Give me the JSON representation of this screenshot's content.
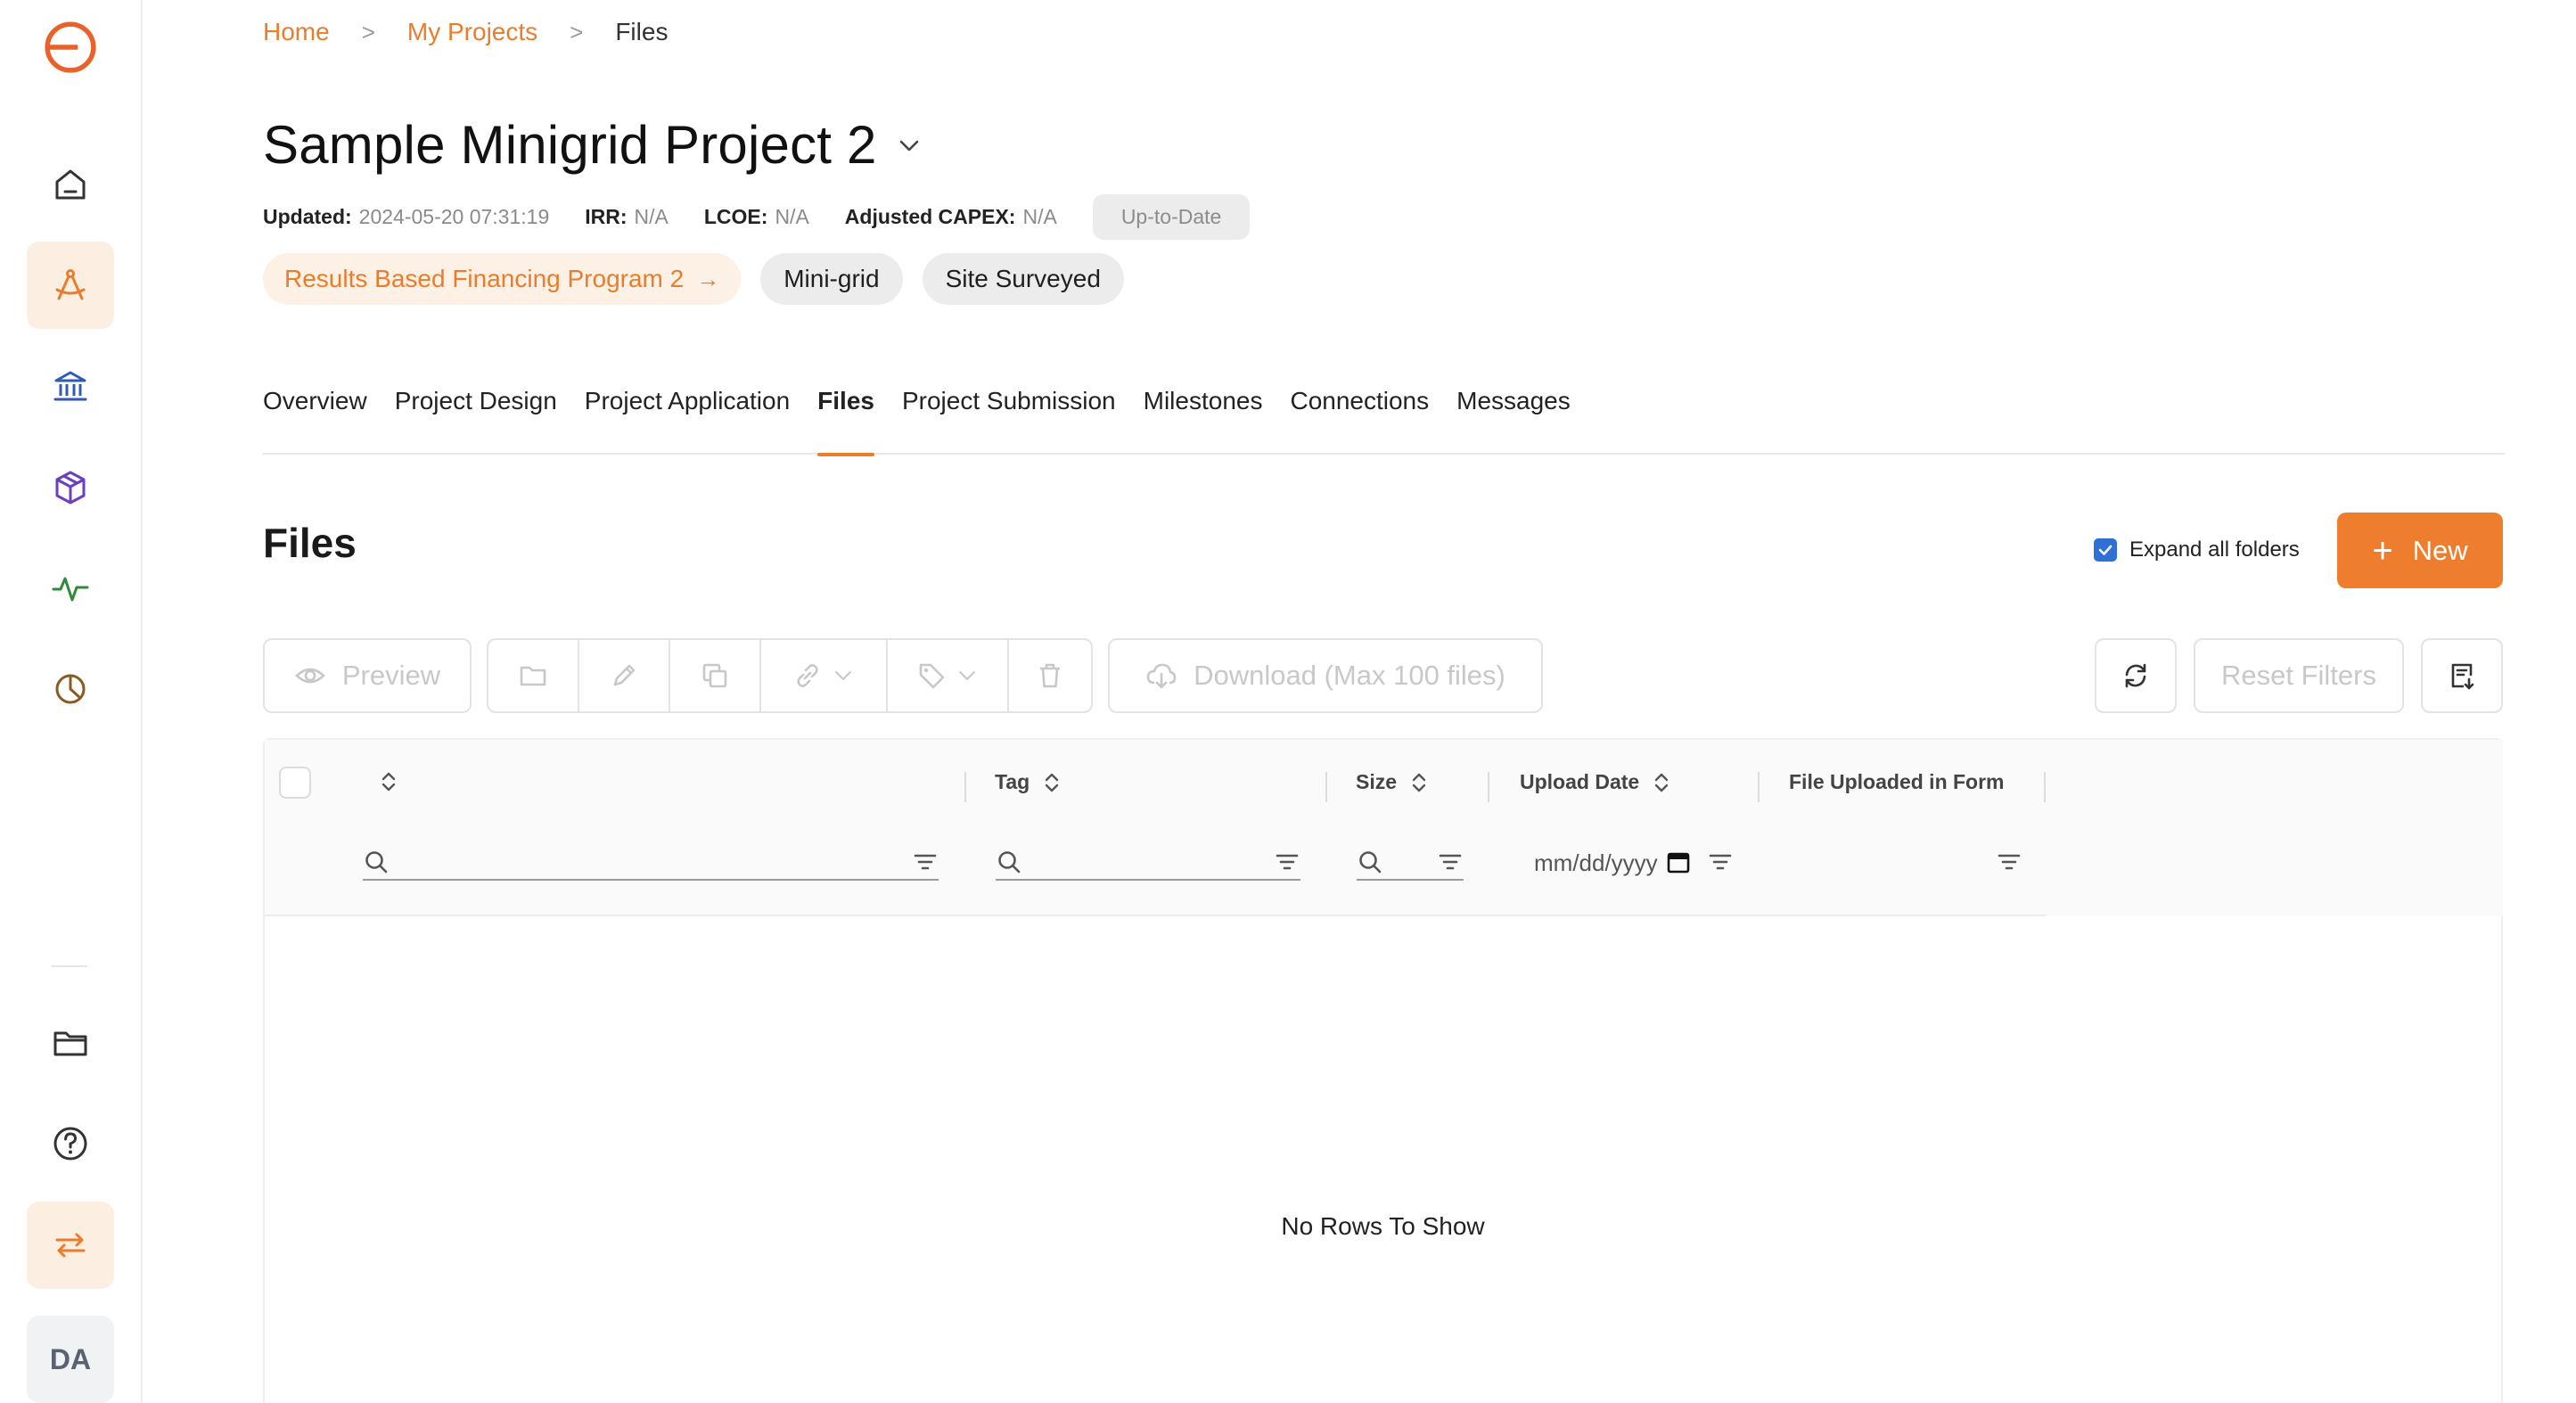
{
  "sidebar": {
    "logo": "brand-logo-icon",
    "items": [
      {
        "name": "home",
        "icon": "home-icon"
      },
      {
        "name": "projects",
        "icon": "compass-icon",
        "active": true
      },
      {
        "name": "institutions",
        "icon": "bank-icon"
      },
      {
        "name": "products",
        "icon": "cube-icon"
      },
      {
        "name": "activity",
        "icon": "pulse-icon"
      },
      {
        "name": "analytics",
        "icon": "pie-chart-icon"
      }
    ],
    "bottom": [
      {
        "name": "files",
        "icon": "folder-icon"
      },
      {
        "name": "help",
        "icon": "question-icon"
      },
      {
        "name": "switch",
        "icon": "swap-icon"
      }
    ],
    "avatar": "DA"
  },
  "breadcrumb": {
    "home": "Home",
    "projects": "My Projects",
    "current": "Files",
    "separator": ">"
  },
  "project": {
    "title": "Sample Minigrid Project 2",
    "meta": {
      "updated_label": "Updated:",
      "updated_value": "2024-05-20 07:31:19",
      "irr_label": "IRR:",
      "irr_value": "N/A",
      "lcoe_label": "LCOE:",
      "lcoe_value": "N/A",
      "capex_label": "Adjusted CAPEX:",
      "capex_value": "N/A"
    },
    "status": "Up-to-Date",
    "program": "Results Based Financing Program 2",
    "program_arrow": "→",
    "tags": [
      "Mini-grid",
      "Site Surveyed"
    ]
  },
  "tabs": [
    {
      "label": "Overview"
    },
    {
      "label": "Project Design"
    },
    {
      "label": "Project Application"
    },
    {
      "label": "Files",
      "active": true
    },
    {
      "label": "Project Submission"
    },
    {
      "label": "Milestones"
    },
    {
      "label": "Connections"
    },
    {
      "label": "Messages"
    }
  ],
  "files": {
    "title": "Files",
    "expand_label": "Expand all folders",
    "expand_checked": true,
    "new_label": "New",
    "new_plus": "+",
    "toolbar": {
      "preview": "Preview",
      "download": "Download (Max 100 files)",
      "reset": "Reset Filters"
    },
    "columns": {
      "tag": "Tag",
      "size": "Size",
      "upload_date": "Upload Date",
      "form": "File Uploaded in Form"
    },
    "date_placeholder": "mm/dd/yyyy",
    "empty": "No Rows To Show"
  },
  "colors": {
    "accent": "#ee7e2e",
    "accent_light": "#fdeee2",
    "checkbox": "#2f6fd6"
  }
}
